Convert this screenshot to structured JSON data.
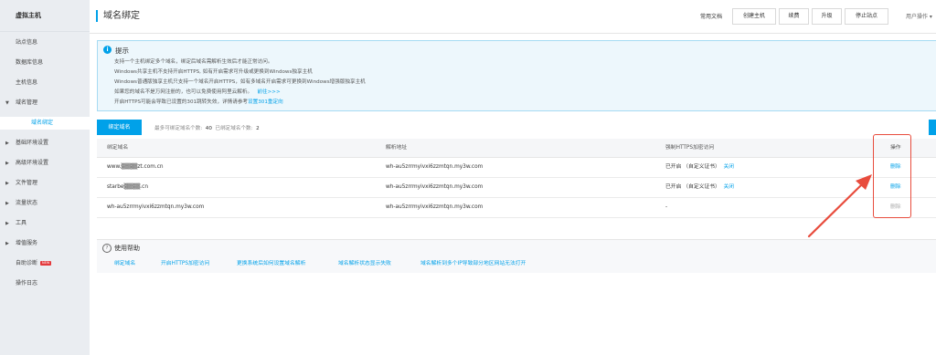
{
  "sidebar": {
    "title": "虚拟主机",
    "items": [
      {
        "label": "站点信息"
      },
      {
        "label": "数据库信息"
      },
      {
        "label": "主机信息"
      },
      {
        "label": "域名管理",
        "arrow": "▼"
      },
      {
        "label": "域名绑定"
      },
      {
        "label": "基础环境设置",
        "arrow": "▶"
      },
      {
        "label": "高级环境设置",
        "arrow": "▶"
      },
      {
        "label": "文件管理",
        "arrow": "▶"
      },
      {
        "label": "流量状态",
        "arrow": "▶"
      },
      {
        "label": "工具",
        "arrow": "▶"
      },
      {
        "label": "增值服务",
        "arrow": "▶"
      },
      {
        "label": "自助诊断",
        "badge": "NEW"
      },
      {
        "label": "操作日志"
      }
    ]
  },
  "header": {
    "title": "域名绑定",
    "doc_link": "常用文档",
    "buttons": [
      "创建主机",
      "续费",
      "升级",
      "停止站点"
    ],
    "user_op": "用户操作 ▾"
  },
  "tip": {
    "icon": "i",
    "title": "提示",
    "lines": [
      "支持一个主机绑定多个域名，绑定后域名需解析生效后才能正常访问。",
      "Windows共享主机不支持开启HTTPS, 如有开启需求可升级或更换到Windows独享主机",
      "Windows普通版独享主机只支持一个域名开启HTTPS，如有多域名开启需求可更换到Windows增强版独享主机",
      "如果您的域名不是万网注册的，也可以免费使用阿里云解析。"
    ],
    "line4_link": "前往>>>",
    "line5_prefix": "开启HTTPS可能会导致已设置的301跳转失效，详情请参考",
    "line5_link": "设置301重定向"
  },
  "tabs": {
    "active": "绑定域名",
    "info_max_label": "最多可绑定域名个数:",
    "info_max": "40",
    "info_bound_label": "已绑定域名个数:",
    "info_bound": "2"
  },
  "table": {
    "headers": [
      "绑定域名",
      "解析地址",
      "强制HTTPS加密访问",
      "操作"
    ],
    "rows": [
      {
        "domain": "www.▒▒▒▒zt.com.cn",
        "resolve": "wh-au5zrrmyivxi6zzmtqn.my3w.com",
        "https": "已开启  （自定义证书）",
        "https_link": "关闭",
        "op": "删除",
        "op_disabled": false
      },
      {
        "domain": "starbe▒▒▒▒.cn",
        "resolve": "wh-au5zrrmyivxi6zzmtqn.my3w.com",
        "https": "已开启  （自定义证书）",
        "https_link": "关闭",
        "op": "删除",
        "op_disabled": false
      },
      {
        "domain": "wh-au5zrrmyivxi6zzmtqn.my3w.com",
        "resolve": "wh-au5zrrmyivxi6zzmtqn.my3w.com",
        "https": "-",
        "https_link": "",
        "op": "删除",
        "op_disabled": true
      }
    ]
  },
  "help": {
    "icon": "?",
    "title": "使用帮助",
    "links": [
      "绑定域名",
      "开启HTTPS加密访问",
      "更换系统后如何设置域名解析",
      "域名解析状态显示失败",
      "域名解析到多个IP导致部分地区网站无法打开"
    ]
  },
  "colors": {
    "accent": "#00a1e9",
    "annotation": "#e84c3d"
  }
}
